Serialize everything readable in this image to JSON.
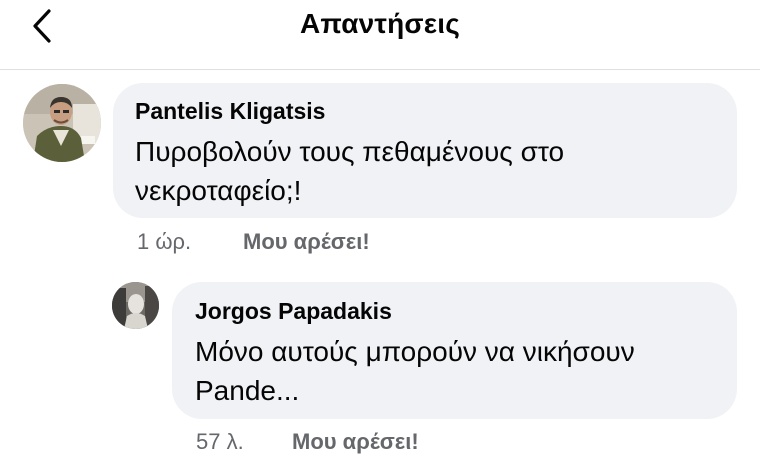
{
  "header": {
    "title": "Απαντήσεις",
    "back_icon": "chevron-left-icon"
  },
  "comments": [
    {
      "author": "Pantelis Kligatsis",
      "text_lines": [
        "Πυροβολούν τους πεθαμένους στο",
        "νεκροταφείο;!"
      ],
      "time": "1 ώρ.",
      "like_label": "Μου αρέσει!"
    },
    {
      "author": "Jorgos Papadakis",
      "text_lines": [
        "Μόνο αυτούς μπορούν να νικήσουν",
        "Pande..."
      ],
      "time": "57 λ.",
      "like_label": "Μου αρέσει!"
    }
  ],
  "colors": {
    "bubble": "#f0f2f5",
    "meta_text": "#65676b",
    "divider": "#dddfe2"
  }
}
